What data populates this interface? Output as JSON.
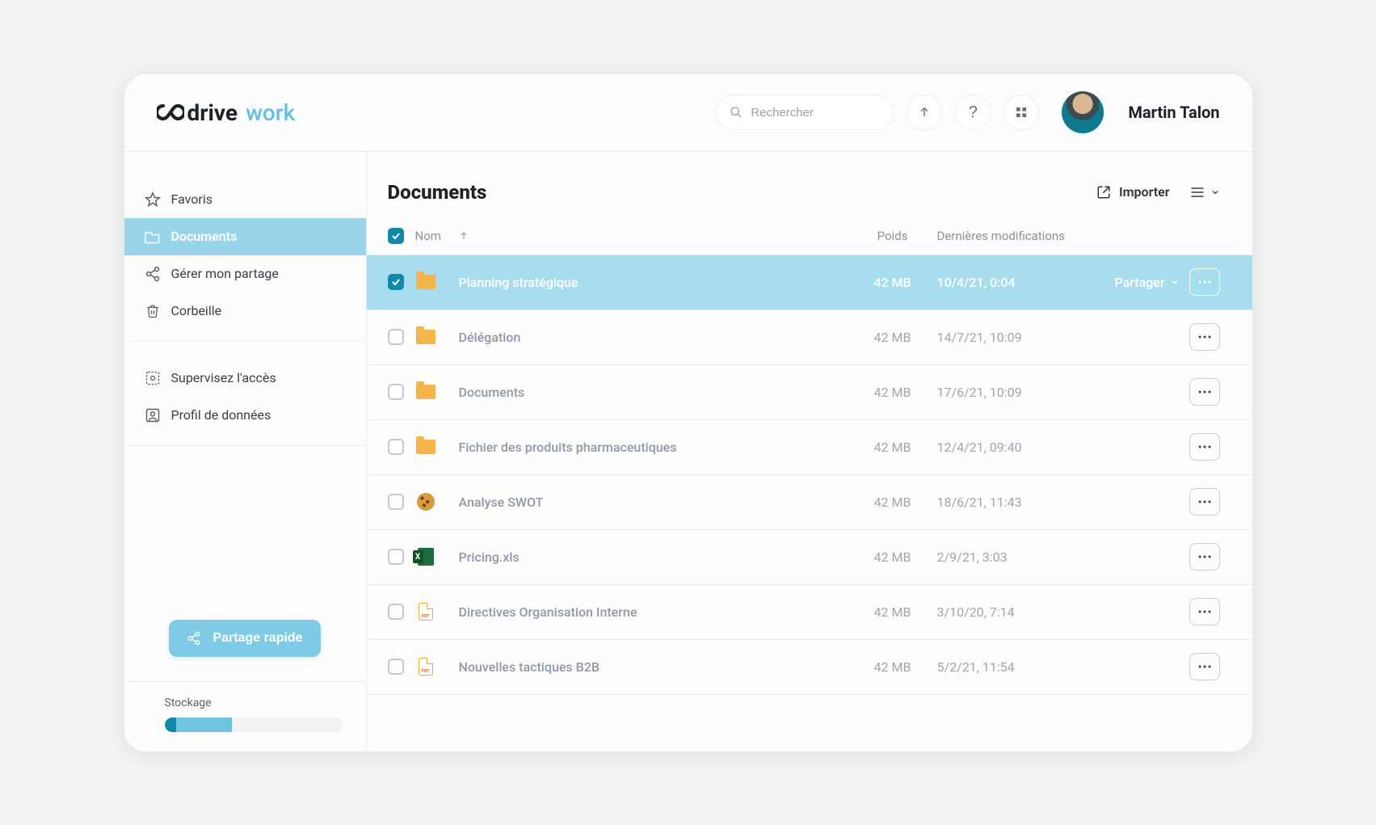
{
  "header": {
    "brand_main": "drive",
    "brand_sub": "work",
    "search_placeholder": "Rechercher",
    "user_name": "Martin Talon"
  },
  "sidebar": {
    "items": [
      {
        "label": "Favoris",
        "icon": "star-icon",
        "active": false
      },
      {
        "label": "Documents",
        "icon": "folder-icon",
        "active": true
      },
      {
        "label": "Gérer mon partage",
        "icon": "share-icon",
        "active": false
      },
      {
        "label": "Corbeille",
        "icon": "trash-icon",
        "active": false
      }
    ],
    "admin_items": [
      {
        "label": "Supervisez l'accès",
        "icon": "supervise-icon"
      },
      {
        "label": "Profil de données",
        "icon": "profile-icon"
      }
    ],
    "quick_share_label": "Partage rapide",
    "storage_label": "Stockage",
    "storage_percent": 38
  },
  "main": {
    "page_title": "Documents",
    "import_label": "Importer",
    "columns": {
      "name": "Nom",
      "size": "Poids",
      "modified": "Dernières modifications"
    },
    "share_label": "Partager",
    "header_checked": true,
    "files": [
      {
        "name": "Planning stratégique",
        "type": "folder",
        "size": "42 MB",
        "modified": "10/4/21, 0:04",
        "selected": true
      },
      {
        "name": "Délégation",
        "type": "folder",
        "size": "42 MB",
        "modified": "14/7/21, 10:09",
        "selected": false
      },
      {
        "name": "Documents",
        "type": "folder",
        "size": "42 MB",
        "modified": "17/6/21, 10:09",
        "selected": false
      },
      {
        "name": "Fichier des produits pharmaceutiques",
        "type": "folder",
        "size": "42 MB",
        "modified": "12/4/21, 09:40",
        "selected": false
      },
      {
        "name": "Analyse SWOT",
        "type": "cookie",
        "size": "42 MB",
        "modified": "18/6/21, 11:43",
        "selected": false
      },
      {
        "name": "Pricing.xls",
        "type": "excel",
        "size": "42 MB",
        "modified": "2/9/21, 3:03",
        "selected": false
      },
      {
        "name": "Directives Organisation Interne",
        "type": "pdf",
        "size": "42 MB",
        "modified": "3/10/20, 7:14",
        "selected": false
      },
      {
        "name": "Nouvelles tactiques B2B",
        "type": "pdf",
        "size": "42 MB",
        "modified": "5/2/21, 11:54",
        "selected": false
      }
    ]
  }
}
